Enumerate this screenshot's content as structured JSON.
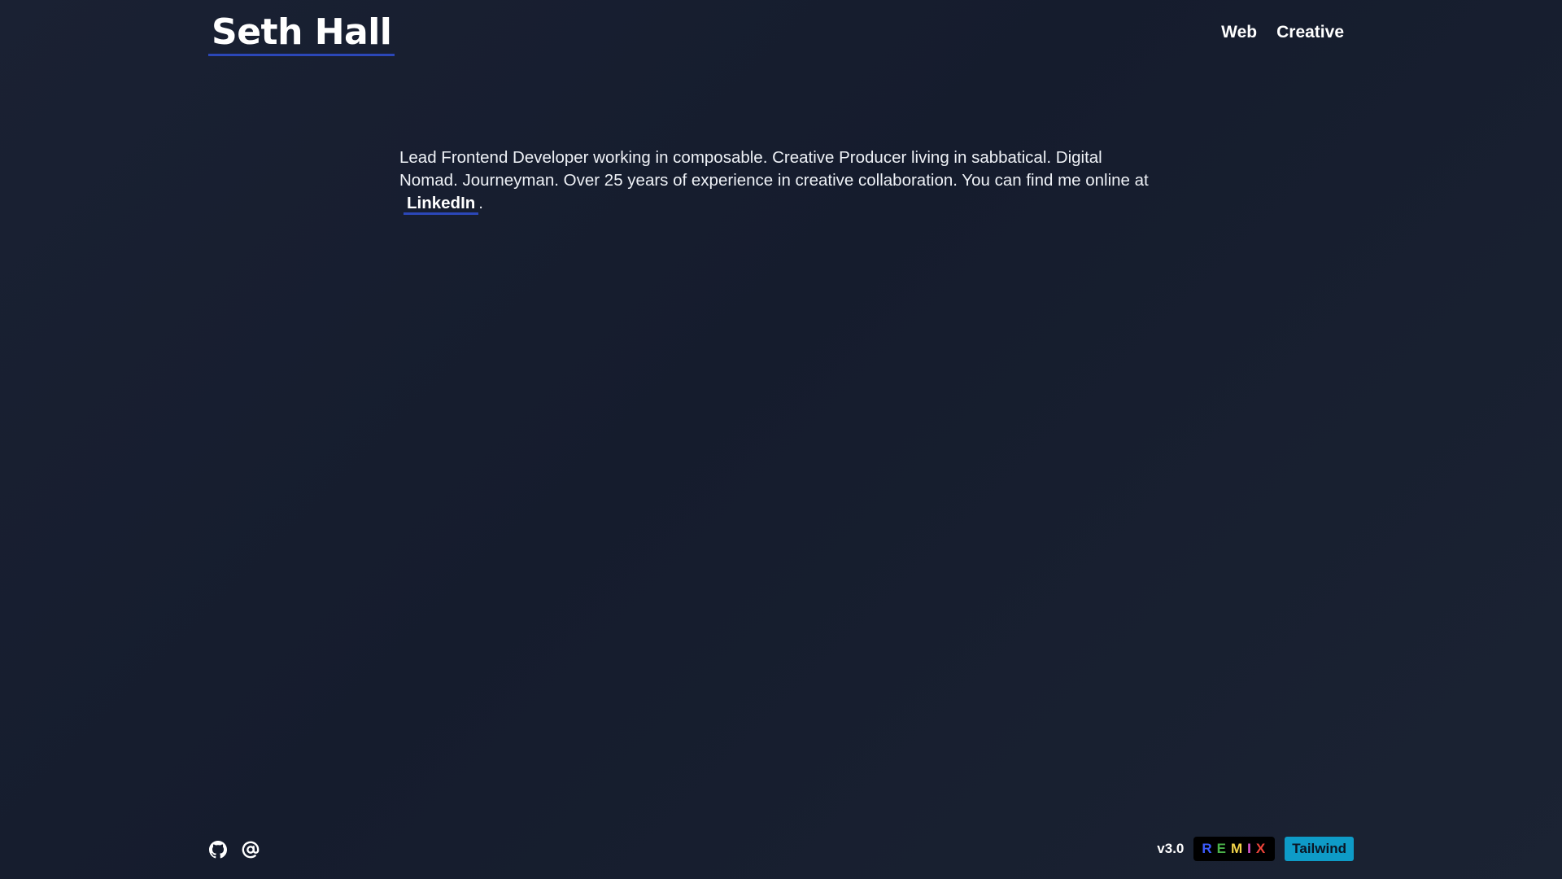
{
  "header": {
    "site_title": "Seth Hall",
    "nav": [
      {
        "label": "Web"
      },
      {
        "label": "Creative"
      }
    ]
  },
  "main": {
    "intro_text": "Lead Frontend Developer working in composable. Creative Producer living in sabbatical. Digital Nomad. Journeyman. Over 25 years of experience in creative collaboration. You can find me online at",
    "link_label": "LinkedIn",
    "trailing": "."
  },
  "footer": {
    "icons": [
      {
        "name": "github-icon"
      },
      {
        "name": "at-sign-icon"
      }
    ],
    "version": "v3.0",
    "remix_letters": [
      {
        "char": "R",
        "color": "#3c5bff"
      },
      {
        "char": "E",
        "color": "#4ab34a"
      },
      {
        "char": "M",
        "color": "#f3d44a"
      },
      {
        "char": "I",
        "color": "#e05ad8"
      },
      {
        "char": "X",
        "color": "#f0443a"
      }
    ],
    "tailwind_label": "Tailwind"
  },
  "colors": {
    "background": "#171e2f",
    "accent_underline": "#2b47b8",
    "tailwind_badge": "#0e9bc7"
  }
}
